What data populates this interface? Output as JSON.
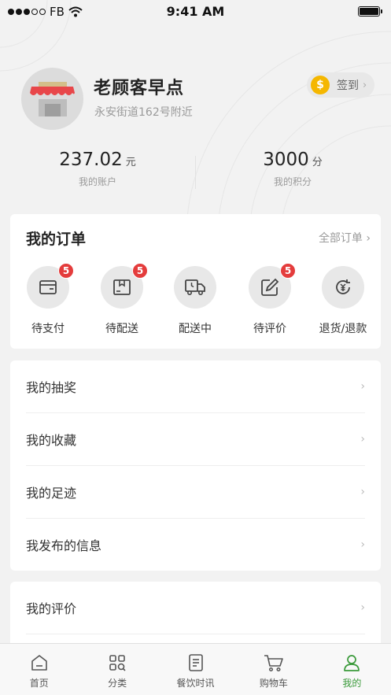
{
  "status_bar": {
    "carrier": "FB",
    "time": "9:41 AM"
  },
  "profile": {
    "shop_name": "老顾客早点",
    "address": "永安街道162号附近",
    "signin_label": "签到",
    "coin_symbol": "$"
  },
  "stats": {
    "balance_value": "237.02",
    "balance_unit": "元",
    "balance_label": "我的账户",
    "points_value": "3000",
    "points_unit": "分",
    "points_label": "我的积分"
  },
  "orders": {
    "title": "我的订单",
    "view_all": "全部订单 ›",
    "items": [
      {
        "label": "待支付",
        "icon": "wallet-icon",
        "badge": "5"
      },
      {
        "label": "待配送",
        "icon": "package-icon",
        "badge": "5"
      },
      {
        "label": "配送中",
        "icon": "truck-icon",
        "badge": ""
      },
      {
        "label": "待评价",
        "icon": "edit-icon",
        "badge": "5"
      },
      {
        "label": "退货/退款",
        "icon": "refund-icon",
        "badge": ""
      }
    ]
  },
  "menu_group_1": [
    {
      "label": "我的抽奖"
    },
    {
      "label": "我的收藏"
    },
    {
      "label": "我的足迹"
    },
    {
      "label": "我发布的信息"
    }
  ],
  "menu_group_2": [
    {
      "label": "我的评价"
    }
  ],
  "chevron": "›",
  "tab_bar": {
    "items": [
      {
        "label": "首页",
        "icon": "home-icon",
        "active": false
      },
      {
        "label": "分类",
        "icon": "category-icon",
        "active": false
      },
      {
        "label": "餐饮时讯",
        "icon": "news-icon",
        "active": false
      },
      {
        "label": "购物车",
        "icon": "cart-icon",
        "active": false
      },
      {
        "label": "我的",
        "icon": "profile-icon",
        "active": true
      }
    ]
  },
  "colors": {
    "accent_green": "#3a9a3a",
    "badge_red": "#e43c3c",
    "coin_gold": "#f5b700",
    "awning_red": "#e8474a"
  }
}
